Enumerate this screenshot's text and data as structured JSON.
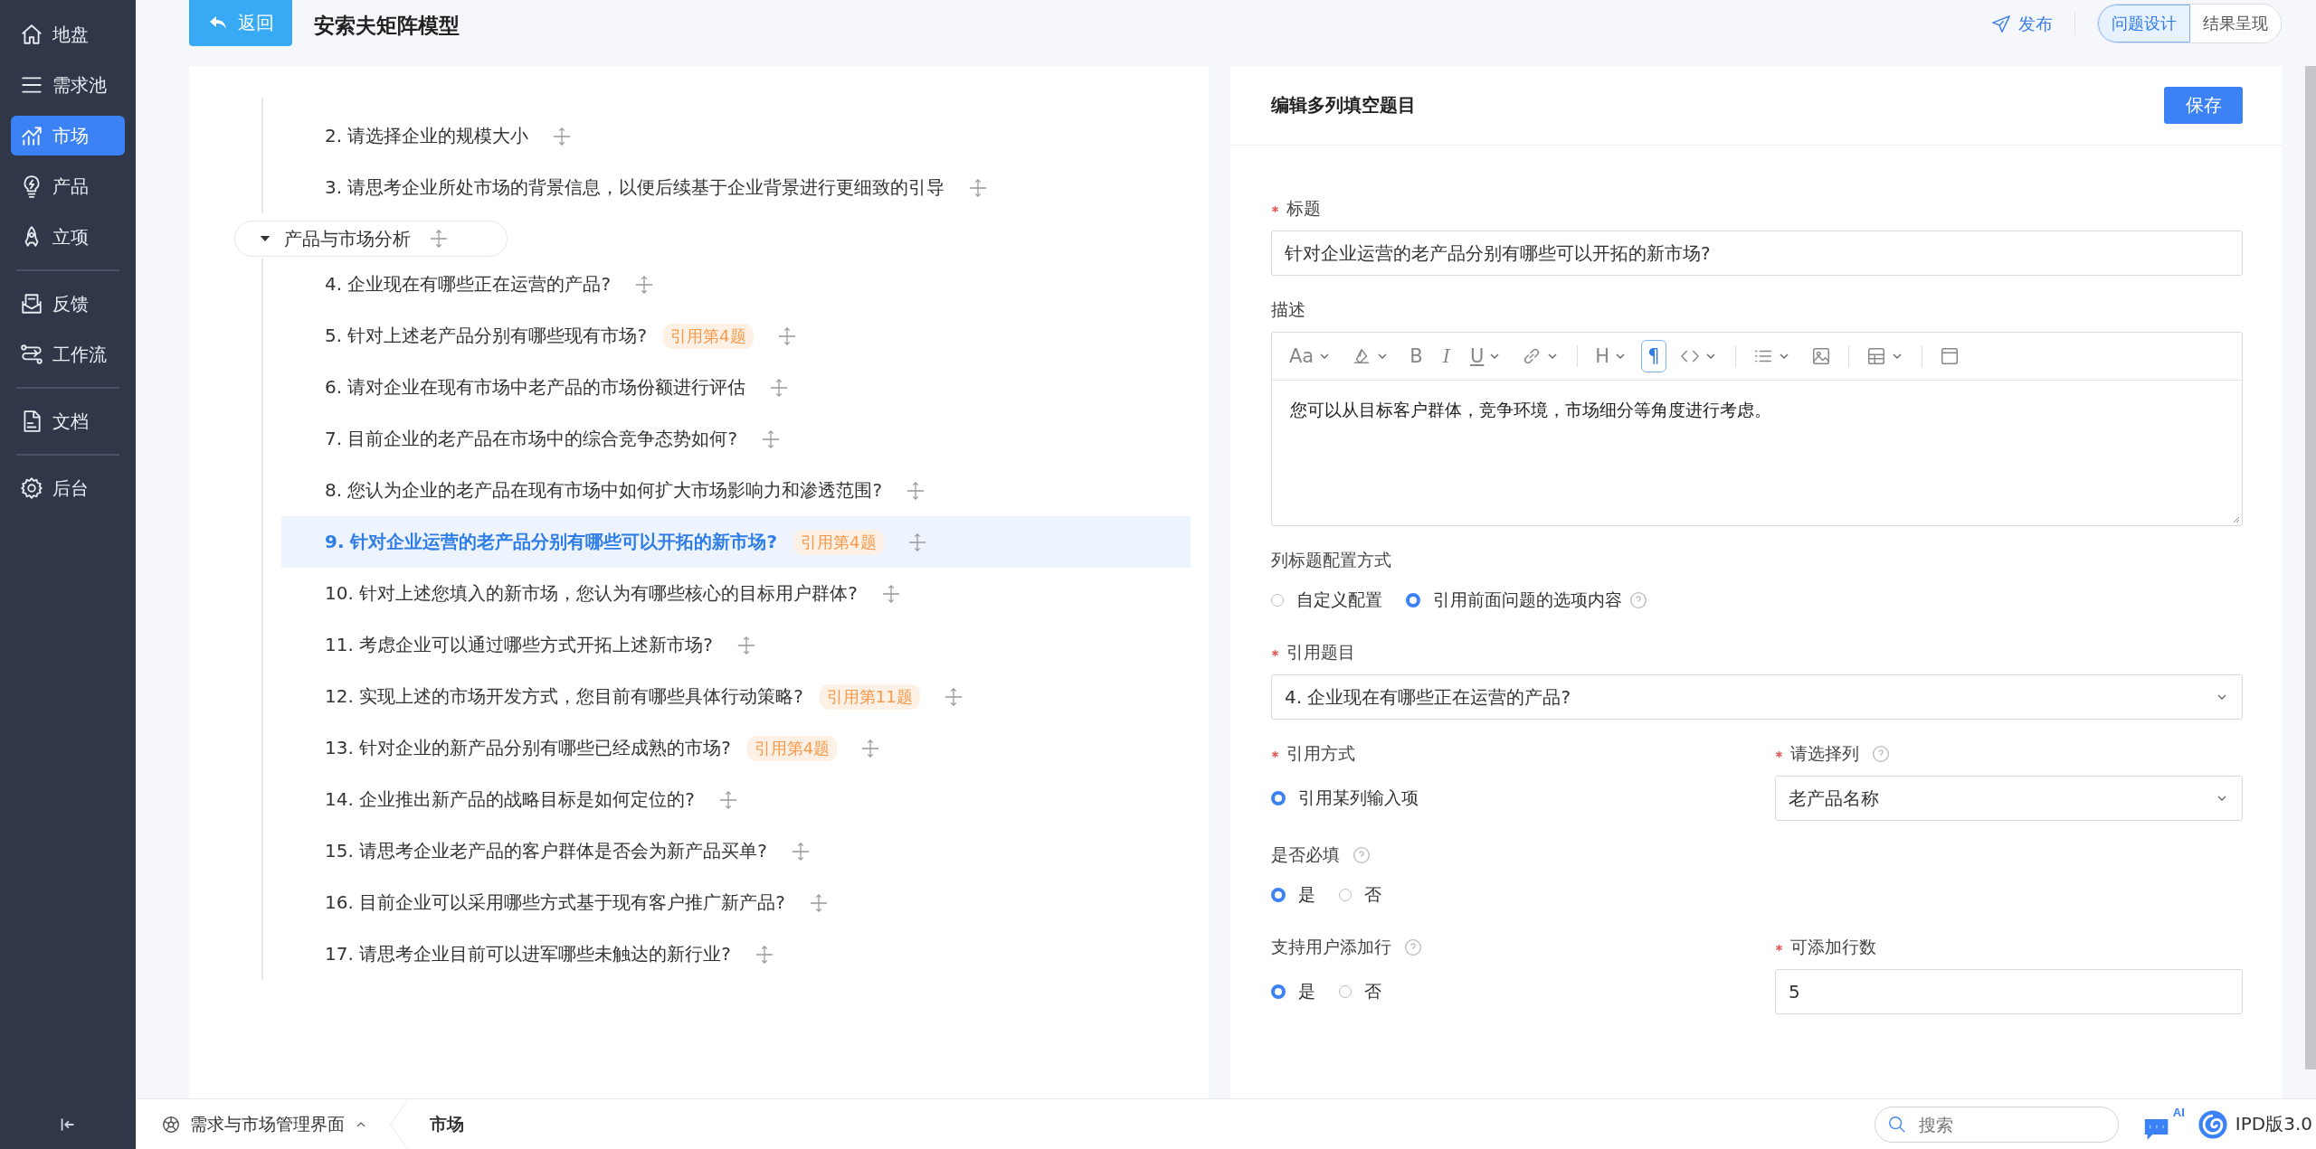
{
  "sidebar": {
    "groups": [
      {
        "items": [
          {
            "kind": "home",
            "label": "地盘",
            "selected": false
          },
          {
            "kind": "list",
            "label": "需求池",
            "selected": false
          },
          {
            "kind": "chart",
            "label": "市场",
            "selected": true
          },
          {
            "kind": "bulb",
            "label": "产品",
            "selected": false
          },
          {
            "kind": "rocket",
            "label": "立项",
            "selected": false
          }
        ]
      },
      {
        "items": [
          {
            "kind": "feedback",
            "label": "反馈",
            "selected": false
          },
          {
            "kind": "flow",
            "label": "工作流",
            "selected": false
          }
        ]
      },
      {
        "items": [
          {
            "kind": "doc",
            "label": "文档",
            "selected": false
          }
        ]
      },
      {
        "items": [
          {
            "kind": "gear",
            "label": "后台",
            "selected": false
          }
        ]
      }
    ]
  },
  "header": {
    "back_button": "返回",
    "title": "安索夫矩阵模型",
    "publish": "发布",
    "view_tabs": [
      {
        "label": "问题设计",
        "selected": true
      },
      {
        "label": "结果呈现",
        "selected": false
      }
    ]
  },
  "outline": {
    "items": [
      {
        "kind": "question",
        "label": "2. 请选择企业的规模大小",
        "selected": false
      },
      {
        "kind": "question",
        "label": "3. 请思考企业所处市场的背景信息，以便后续基于企业背景进行更细致的引导",
        "selected": false
      },
      {
        "kind": "section",
        "label": "产品与市场分析",
        "expanded": true,
        "children": [
          {
            "label": "4. 企业现在有哪些正在运营的产品?",
            "selected": false
          },
          {
            "label": "5. 针对上述老产品分别有哪些现有市场?",
            "tag": "引用第4题",
            "selected": false
          },
          {
            "label": "6. 请对企业在现有市场中老产品的市场份额进行评估",
            "selected": false
          },
          {
            "label": "7. 目前企业的老产品在市场中的综合竞争态势如何?",
            "selected": false
          },
          {
            "label": "8. 您认为企业的老产品在现有市场中如何扩大市场影响力和渗透范围?",
            "selected": false
          },
          {
            "label": "9. 针对企业运营的老产品分别有哪些可以开拓的新市场?",
            "tag": "引用第4题",
            "selected": true
          },
          {
            "label": "10. 针对上述您填入的新市场，您认为有哪些核心的目标用户群体?",
            "selected": false
          },
          {
            "label": "11. 考虑企业可以通过哪些方式开拓上述新市场?",
            "selected": false
          },
          {
            "label": "12. 实现上述的市场开发方式，您目前有哪些具体行动策略?",
            "tag": "引用第11题",
            "selected": false
          },
          {
            "label": "13. 针对企业的新产品分别有哪些已经成熟的市场?",
            "tag": "引用第4题",
            "selected": false
          },
          {
            "label": "14. 企业推出新产品的战略目标是如何定位的?",
            "selected": false
          },
          {
            "label": "15. 请思考企业老产品的客户群体是否会为新产品买单?",
            "selected": false
          },
          {
            "label": "16. 目前企业可以采用哪些方式基于现有客户推广新产品?",
            "selected": false
          },
          {
            "label": "17. 请思考企业目前可以进军哪些未触达的新行业?",
            "selected": false
          }
        ]
      }
    ]
  },
  "editor": {
    "title": "编辑多列填空题目",
    "save_button": "保存",
    "title_field": {
      "label": "标题",
      "required": true,
      "value": "针对企业运营的老产品分别有哪些可以开拓的新市场?"
    },
    "description": {
      "label": "描述",
      "content": "您可以从目标客户群体，竞争环境，市场细分等角度进行考虑。",
      "toolbar": [
        {
          "kind": "font",
          "glyph": "Aa",
          "dropdown": true,
          "selected": false
        },
        {
          "kind": "color",
          "dropdown": true,
          "selected": false
        },
        {
          "kind": "bold",
          "glyph": "B",
          "dropdown": false,
          "selected": false
        },
        {
          "kind": "italic",
          "glyph": "I",
          "dropdown": false,
          "selected": false
        },
        {
          "kind": "underline",
          "glyph": "U",
          "dropdown": true,
          "selected": false
        },
        {
          "kind": "link",
          "dropdown": true,
          "selected": false
        },
        {
          "kind": "divider"
        },
        {
          "kind": "heading",
          "glyph": "H",
          "dropdown": true,
          "selected": false
        },
        {
          "kind": "paragraph",
          "glyph": "¶",
          "dropdown": false,
          "selected": true
        },
        {
          "kind": "code",
          "dropdown": true,
          "selected": false
        },
        {
          "kind": "divider"
        },
        {
          "kind": "list",
          "dropdown": true,
          "selected": false
        },
        {
          "kind": "image",
          "dropdown": false,
          "selected": false
        },
        {
          "kind": "divider"
        },
        {
          "kind": "table",
          "dropdown": true,
          "selected": false
        },
        {
          "kind": "divider"
        },
        {
          "kind": "fullscreen",
          "dropdown": false,
          "selected": false
        }
      ]
    },
    "column_config": {
      "label": "列标题配置方式",
      "help": true,
      "options": [
        {
          "label": "自定义配置",
          "selected": false
        },
        {
          "label": "引用前面问题的选项内容",
          "selected": true
        }
      ]
    },
    "referenced_question": {
      "label": "引用题目",
      "required": true,
      "value": "4. 企业现在有哪些正在运营的产品?"
    },
    "reference_mode": {
      "label": "引用方式",
      "required": true,
      "options": [
        {
          "label": "引用某列输入项",
          "selected": true
        }
      ]
    },
    "column_select": {
      "label": "请选择列",
      "required": true,
      "help": true,
      "value": "老产品名称"
    },
    "required_setting": {
      "label": "是否必填",
      "help": true,
      "options": [
        {
          "label": "是",
          "selected": true
        },
        {
          "label": "否",
          "selected": false
        }
      ]
    },
    "allow_add_rows": {
      "label": "支持用户添加行",
      "help": true,
      "options": [
        {
          "label": "是",
          "selected": true
        },
        {
          "label": "否",
          "selected": false
        }
      ]
    },
    "row_count": {
      "label": "可添加行数",
      "required": true,
      "value": "5"
    }
  },
  "bottom_bar": {
    "breadcrumb": [
      {
        "label": "需求与市场管理界面",
        "dropdown": true,
        "current": false
      },
      {
        "label": "市场",
        "dropdown": false,
        "current": true
      }
    ],
    "search": {
      "placeholder": "搜索"
    },
    "ai_badge": "AI",
    "version": "IPD版3.0"
  }
}
